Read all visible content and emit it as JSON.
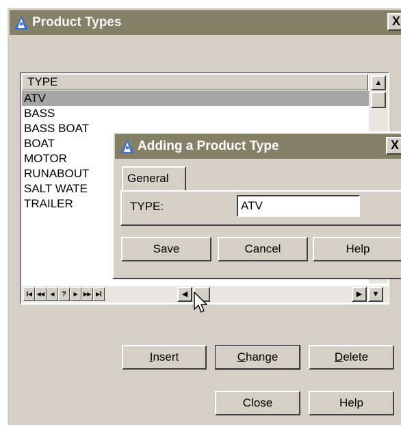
{
  "main_window": {
    "title": "Product Types",
    "close_glyph": "X",
    "list": {
      "column_header": "TYPE",
      "rows": [
        "ATV",
        "BASS",
        "BASS BOAT",
        "BOAT",
        "MOTOR",
        "RUNABOUT",
        "SALT WATE",
        "TRAILER"
      ],
      "selected_index": 0
    },
    "navigator": [
      "I◂",
      "◂◂",
      "◂",
      "?",
      "▸",
      "▸▸",
      "▸I"
    ],
    "buttons": {
      "insert": "nsert",
      "insert_key": "I",
      "change": "hange",
      "change_key": "C",
      "delete": "elete",
      "delete_key": "D",
      "close": "Close",
      "help": "Help"
    }
  },
  "sub_dialog": {
    "title": "Adding a Product Type",
    "close_glyph": "X",
    "tab_label": "General",
    "field_label": "TYPE:",
    "field_value": "ATV",
    "buttons": {
      "save": "Save",
      "cancel": "Cancel",
      "help": "Help"
    }
  },
  "colors": {
    "titlebar": "#858166",
    "face": "#d4d0c8",
    "selection": "#a6a6a6"
  },
  "icons": {
    "app": "triangle-app-icon",
    "cursor": "mouse-pointer-icon"
  }
}
